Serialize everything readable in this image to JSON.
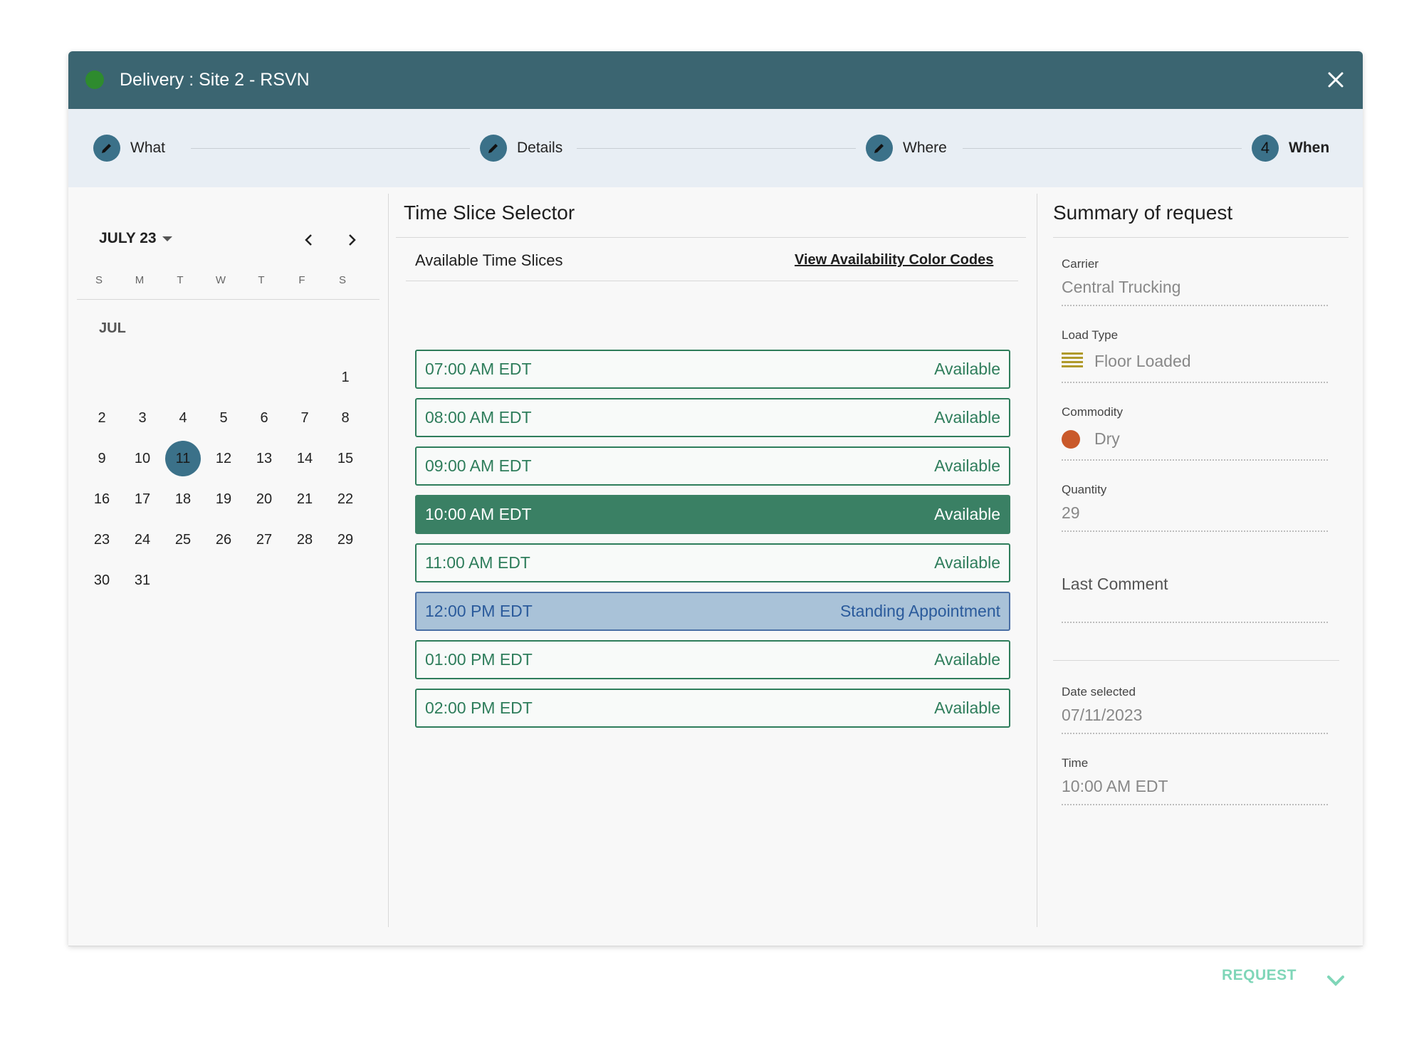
{
  "header": {
    "title": "Delivery : Site 2 - RSVN",
    "status_color": "#2e8b2e"
  },
  "stepper": {
    "steps": [
      {
        "label": "What",
        "icon": "pencil-icon"
      },
      {
        "label": "Details",
        "icon": "pencil-icon"
      },
      {
        "label": "Where",
        "icon": "pencil-icon"
      },
      {
        "label": "When",
        "number": "4"
      }
    ]
  },
  "calendar": {
    "month_label": "JULY 23",
    "days_of_week": [
      "S",
      "M",
      "T",
      "W",
      "T",
      "F",
      "S"
    ],
    "month_short": "JUL",
    "selected_day": "11",
    "weeks": [
      [
        "",
        "",
        "",
        "",
        "",
        "",
        "1"
      ],
      [
        "2",
        "3",
        "4",
        "5",
        "6",
        "7",
        "8"
      ],
      [
        "9",
        "10",
        "11",
        "12",
        "13",
        "14",
        "15"
      ],
      [
        "16",
        "17",
        "18",
        "19",
        "20",
        "21",
        "22"
      ],
      [
        "23",
        "24",
        "25",
        "26",
        "27",
        "28",
        "29"
      ],
      [
        "30",
        "31",
        "",
        "",
        "",
        "",
        ""
      ]
    ]
  },
  "time_slice": {
    "title": "Time Slice Selector",
    "available_title": "Available Time Slices",
    "color_codes_link": "View Availability Color Codes",
    "slots": [
      {
        "time": "07:00 AM EDT",
        "status": "Available",
        "state": "available"
      },
      {
        "time": "08:00 AM EDT",
        "status": "Available",
        "state": "available"
      },
      {
        "time": "09:00 AM EDT",
        "status": "Available",
        "state": "available"
      },
      {
        "time": "10:00 AM EDT",
        "status": "Available",
        "state": "selected"
      },
      {
        "time": "11:00 AM EDT",
        "status": "Available",
        "state": "available"
      },
      {
        "time": "12:00 PM EDT",
        "status": "Standing Appointment",
        "state": "standing"
      },
      {
        "time": "01:00 PM EDT",
        "status": "Available",
        "state": "available"
      },
      {
        "time": "02:00 PM EDT",
        "status": "Available",
        "state": "available"
      }
    ]
  },
  "summary": {
    "title": "Summary of request",
    "carrier_label": "Carrier",
    "carrier_value": "Central Trucking",
    "load_type_label": "Load Type",
    "load_type_value": "Floor Loaded",
    "commodity_label": "Commodity",
    "commodity_value": "Dry",
    "commodity_color": "#c9592a",
    "quantity_label": "Quantity",
    "quantity_value": "29",
    "comment_label": "Last Comment",
    "date_label": "Date selected",
    "date_value": "07/11/2023",
    "time_label": "Time",
    "time_value": "10:00 AM EDT"
  },
  "footer": {
    "request_label": "REQUEST"
  }
}
